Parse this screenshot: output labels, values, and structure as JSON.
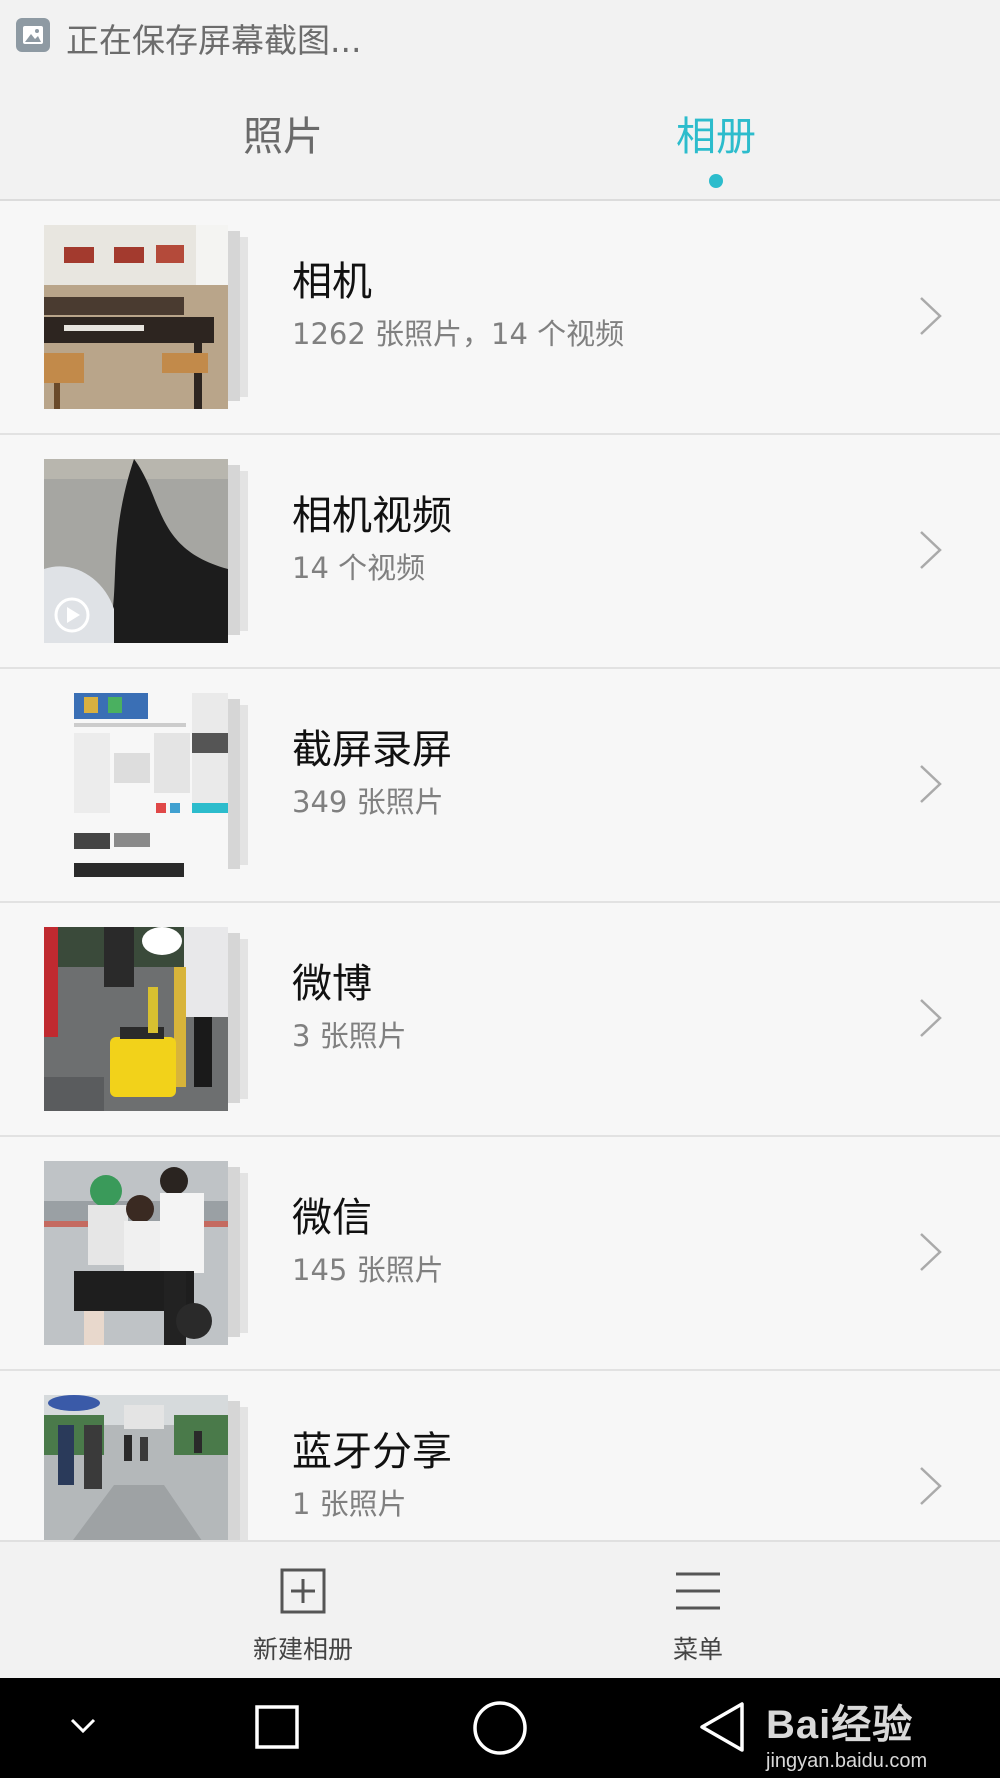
{
  "status_bar": {
    "text": "正在保存屏幕截图...",
    "icon": "image-icon"
  },
  "tabs": [
    {
      "label": "照片",
      "active": false
    },
    {
      "label": "相册",
      "active": true
    }
  ],
  "accent_color": "#2cbccc",
  "albums": [
    {
      "title": "相机",
      "count": "1262 张照片，14 个视频",
      "thumbnail": "classroom-photo"
    },
    {
      "title": "相机视频",
      "count": "14 个视频",
      "thumbnail": "hair-video",
      "is_video": true
    },
    {
      "title": "截屏录屏",
      "count": "349 张照片",
      "thumbnail": "screenshot-collage"
    },
    {
      "title": "微博",
      "count": "3 张照片",
      "thumbnail": "yellow-case-photo"
    },
    {
      "title": "微信",
      "count": "145 张照片",
      "thumbnail": "scooter-photo"
    },
    {
      "title": "蓝牙分享",
      "count": "1 张照片",
      "thumbnail": "campus-rain-photo"
    }
  ],
  "bottom_bar": {
    "new_album": {
      "label": "新建相册",
      "icon": "plus-square-icon"
    },
    "menu": {
      "label": "菜单",
      "icon": "menu-icon"
    }
  },
  "nav_bar": {
    "items": [
      "chevron-down-icon",
      "recents-icon",
      "home-icon",
      "back-icon"
    ]
  },
  "watermark": {
    "brand": "Bai经验",
    "site": "jingyan.baidu.com"
  }
}
